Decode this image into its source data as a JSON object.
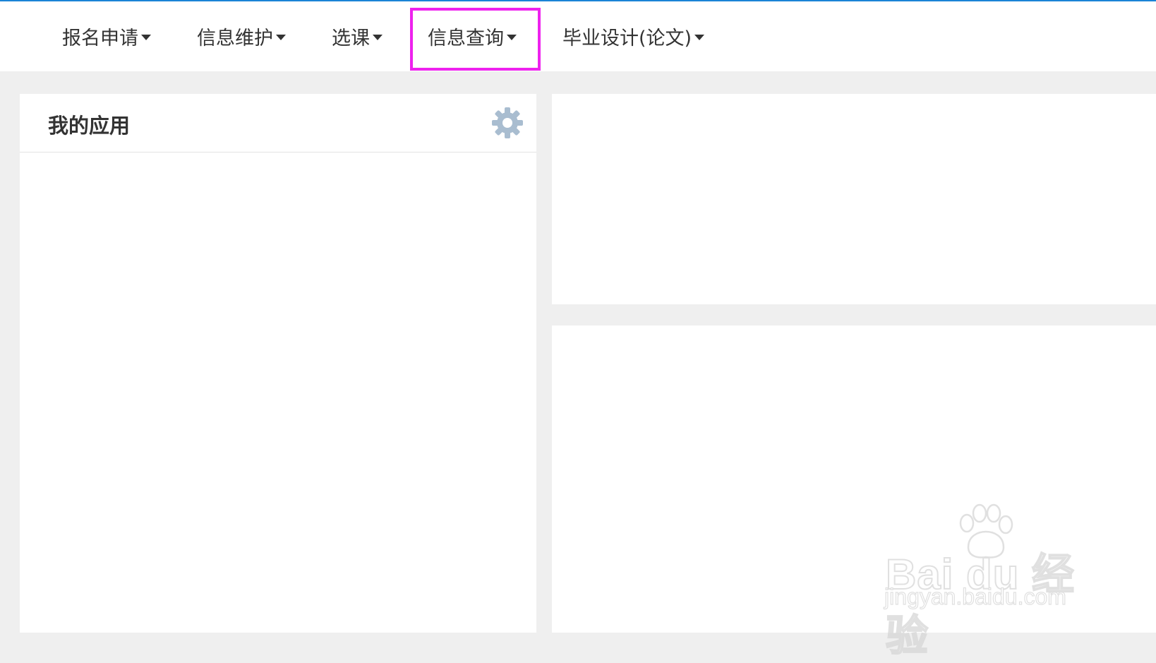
{
  "nav": {
    "items": [
      {
        "label": "报名申请"
      },
      {
        "label": "信息维护"
      },
      {
        "label": "选课"
      },
      {
        "label": "信息查询"
      },
      {
        "label": "毕业设计(论文)"
      }
    ],
    "highlighted_item": "信息查询",
    "highlight_color": "#ee22ee",
    "accent_color": "#1a84d6"
  },
  "apps_panel": {
    "title": "我的应用",
    "settings_icon": "gear-icon"
  },
  "watermark": {
    "brand": "Bai du 经验",
    "url": "jingyan.baidu.com"
  }
}
